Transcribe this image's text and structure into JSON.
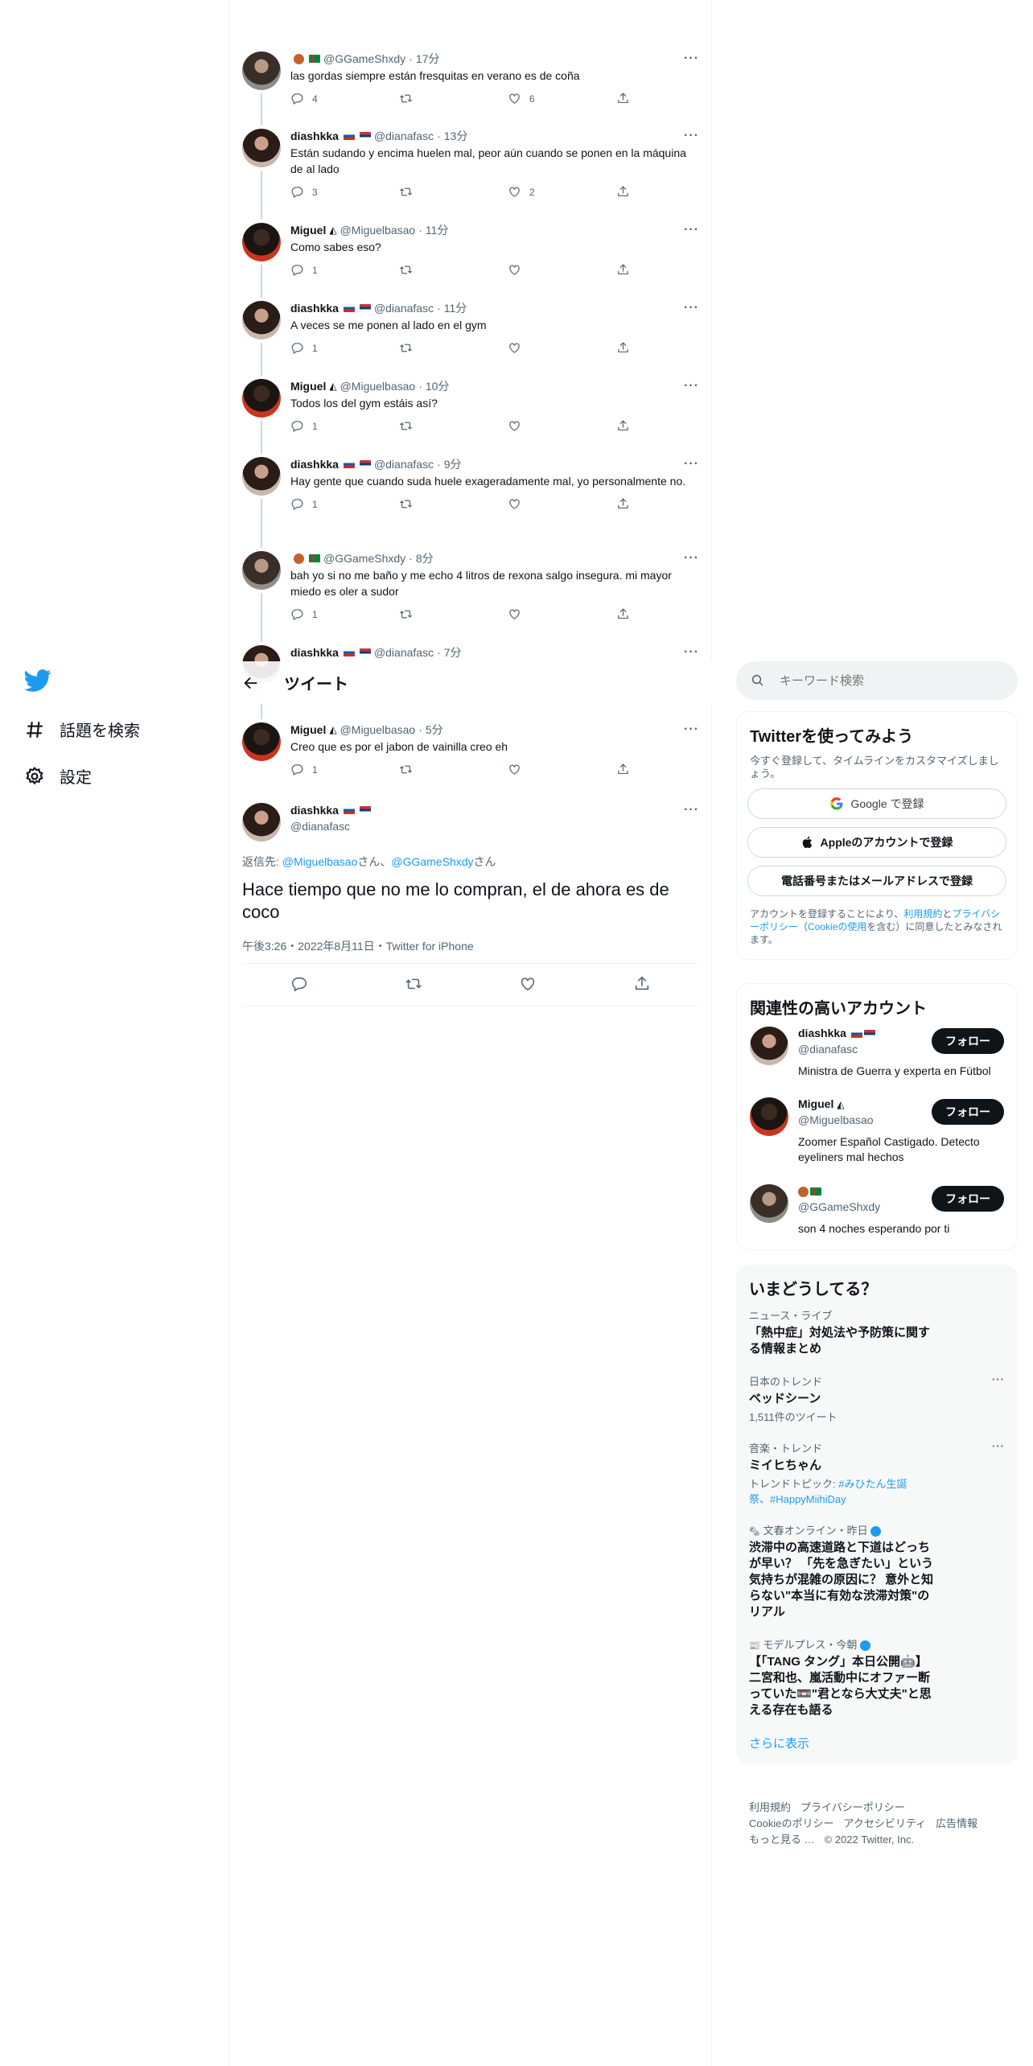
{
  "left_nav": {
    "explore_label": "話題を検索",
    "settings_label": "設定"
  },
  "topbar": {
    "title": "ツイート"
  },
  "thread": [
    {
      "name": "",
      "handle": "@GGameShxdy",
      "time": "17分",
      "text": "las gordas siempre están fresquitas en verano es de coña",
      "replies": "4",
      "retweets": "",
      "likes": "6",
      "avatar": "g",
      "flags": "emoji-tm"
    },
    {
      "name": "diashkka",
      "handle": "@dianafasc",
      "time": "13分",
      "text": "Están sudando y encima huelen mal, peor aún cuando se ponen en la máquina de al lado",
      "replies": "3",
      "retweets": "",
      "likes": "2",
      "avatar": "f",
      "flags": "ru-rs"
    },
    {
      "name": "Miguel",
      "handle": "@Miguelbasao",
      "time": "11分",
      "text": "Como sabes eso?",
      "replies": "1",
      "retweets": "",
      "likes": "",
      "avatar": "m",
      "flags": "tri"
    },
    {
      "name": "diashkka",
      "handle": "@dianafasc",
      "time": "11分",
      "text": "A veces se me ponen al lado en el gym",
      "replies": "1",
      "retweets": "",
      "likes": "",
      "avatar": "f",
      "flags": "ru-rs"
    },
    {
      "name": "Miguel",
      "handle": "@Miguelbasao",
      "time": "10分",
      "text": "Todos los del gym estáis así?",
      "replies": "1",
      "retweets": "",
      "likes": "",
      "avatar": "m",
      "flags": "tri"
    },
    {
      "name": "diashkka",
      "handle": "@dianafasc",
      "time": "9分",
      "text": "Hay gente que cuando suda huele exageradamente mal, yo personalmente no.",
      "replies": "1",
      "retweets": "",
      "likes": "",
      "avatar": "f",
      "flags": "ru-rs"
    },
    {
      "name": "",
      "handle": "@GGameShxdy",
      "time": "8分",
      "text": "bah yo si no me baño y me echo 4 litros de rexona salgo insegura. mi mayor miedo es oler a sudor",
      "replies": "1",
      "retweets": "",
      "likes": "",
      "avatar": "g",
      "flags": "emoji-tm"
    },
    {
      "name": "diashkka",
      "handle": "@dianafasc",
      "time": "7分",
      "text": "",
      "replies": "",
      "retweets": "",
      "likes": "",
      "avatar": "f",
      "flags": "ru-rs"
    },
    {
      "name": "Miguel",
      "handle": "@Miguelbasao",
      "time": "5分",
      "text": "Creo que es por el jabon de vainilla creo eh",
      "replies": "1",
      "retweets": "",
      "likes": "",
      "avatar": "m",
      "flags": "tri"
    }
  ],
  "focus": {
    "name": "diashkka",
    "handle": "@dianafasc",
    "replying_prefix": "返信先: ",
    "reply_to_1": "@Miguelbasao",
    "san_1": "さん、",
    "reply_to_2": "@GGameShxdy",
    "san_2": "さん",
    "text": "Hace tiempo que no me lo compran, el de ahora es de coco",
    "meta": "午後3:26・2022年8月11日・Twitter for iPhone"
  },
  "search": {
    "placeholder": "キーワード検索"
  },
  "signup": {
    "title": "Twitterを使ってみよう",
    "subtitle": "今すぐ登録して、タイムラインをカスタマイズしましょう。",
    "google": "Google で登録",
    "apple": "Appleのアカウントで登録",
    "phone": "電話番号またはメールアドレスで登録",
    "legal_1": "アカウントを登録することにより、",
    "legal_terms": "利用規約",
    "legal_2": "と",
    "legal_privacy": "プライバシーポリシー",
    "legal_3": "（",
    "legal_cookie": "Cookieの使用",
    "legal_4": "を含む）に同意したとみなされます。"
  },
  "relevant": {
    "title": "関連性の高いアカウント",
    "follow_label": "フォロー",
    "accounts": [
      {
        "name": "diashkka",
        "handle": "@dianafasc",
        "bio": "Ministra de Guerra y experta en Fútbol"
      },
      {
        "name": "Miguel",
        "handle": "@Miguelbasao",
        "bio": "Zoomer Español Castigado. Detecto eyeliners mal hechos"
      },
      {
        "name": "",
        "handle": "@GGameShxdy",
        "bio": "son 4 noches esperando por ti"
      }
    ]
  },
  "trends": {
    "title": "いまどうしてる？",
    "items": [
      {
        "context": "ニュース・ライブ",
        "title": "「熱中症」対処法や予防策に関する情報まとめ",
        "extra": ""
      },
      {
        "context": "日本のトレンド",
        "title": "ベッドシーン",
        "extra": "1,511件のツイート"
      },
      {
        "context": "音楽・トレンド",
        "title": "ミイヒちゃん",
        "extra_prefix": "トレンドトピック: ",
        "extra_link": "#みひたん生誕祭、#HappyMiihiDay"
      },
      {
        "context": "文春オンライン・昨日",
        "title": "渋滞中の高速道路と下道はどっちが早い？ 「先を急ぎたい」という気持ちが混雑の原因に？ 意外と知らない\"本当に有効な渋滞対策\"のリアル"
      },
      {
        "context": "モデルプレス・今朝",
        "title": "【「TANG タング」本日公開🤖】二宮和也、嵐活動中にオファー断っていた📼\"君となら大丈夫\"と思える存在も語る"
      }
    ],
    "show_more": "さらに表示"
  },
  "footer": {
    "terms": "利用規約",
    "privacy": "プライバシーポリシー",
    "cookie": "Cookieのポリシー",
    "access": "アクセシビリティ",
    "ads": "広告情報",
    "more": "もっと見る …",
    "copy": "© 2022 Twitter, Inc."
  }
}
